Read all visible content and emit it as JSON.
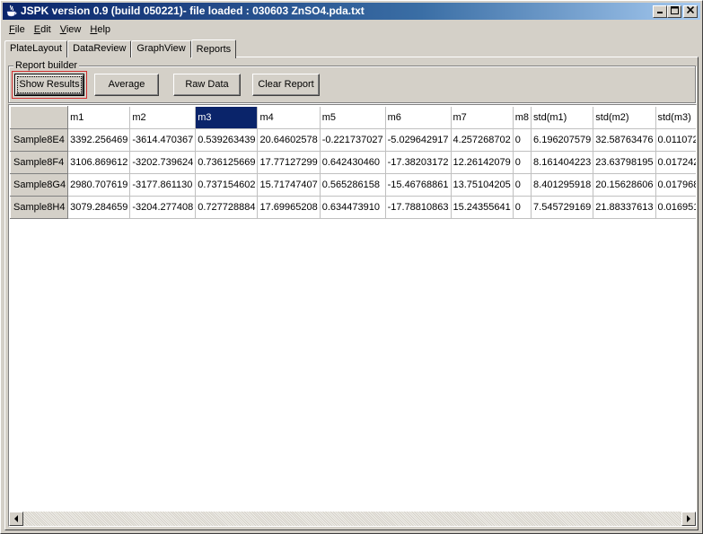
{
  "window": {
    "title": "JSPK version 0.9 (build 050221)- file loaded : 030603 ZnSO4.pda.txt",
    "controls": {
      "minimize": "_",
      "maximize": "□",
      "close": "×"
    }
  },
  "menu": [
    {
      "label_u": "F",
      "label_rest": "ile"
    },
    {
      "label_u": "E",
      "label_rest": "dit"
    },
    {
      "label_u": "V",
      "label_rest": "iew"
    },
    {
      "label_u": "H",
      "label_rest": "elp"
    }
  ],
  "tabs": [
    "PlateLayout",
    "DataReview",
    "GraphView",
    "Reports"
  ],
  "active_tab": "Reports",
  "report_builder": {
    "label": "Report builder",
    "buttons": {
      "show_results": "Show Results",
      "average": "Average",
      "raw_data": "Raw Data",
      "clear_report": "Clear Report"
    }
  },
  "table": {
    "columns": [
      "m1",
      "m2",
      "m3",
      "m4",
      "m5",
      "m6",
      "m7",
      "m8",
      "std(m1)",
      "std(m2)",
      "std(m3)"
    ],
    "selected_column": "m3",
    "rows": [
      {
        "label": "Sample8E4",
        "cells": [
          "3392.256469",
          "-3614.470367",
          "0.539263439",
          "20.64602578",
          "-0.221737027",
          "-5.029642917",
          "4.257268702",
          "0",
          "6.196207579",
          "32.58763476",
          "0.011072"
        ]
      },
      {
        "label": "Sample8F4",
        "cells": [
          "3106.869612",
          "-3202.739624",
          "0.736125669",
          "17.77127299",
          "0.642430460",
          "-17.38203172",
          "12.26142079",
          "0",
          "8.161404223",
          "23.63798195",
          "0.017242"
        ]
      },
      {
        "label": "Sample8G4",
        "cells": [
          "2980.707619",
          "-3177.861130",
          "0.737154602",
          "15.71747407",
          "0.565286158",
          "-15.46768861",
          "13.75104205",
          "0",
          "8.401295918",
          "20.15628606",
          "0.017968"
        ]
      },
      {
        "label": "Sample8H4",
        "cells": [
          "3079.284659",
          "-3204.277408",
          "0.727728884",
          "17.69965208",
          "0.634473910",
          "-17.78810863",
          "15.24355641",
          "0",
          "7.545729169",
          "21.88337613",
          "0.016951"
        ]
      }
    ]
  },
  "colors": {
    "title_active": "#0a246a",
    "selected_header": "#0a246a",
    "face": "#d4d0c8",
    "focus_ring": "#d03030"
  }
}
